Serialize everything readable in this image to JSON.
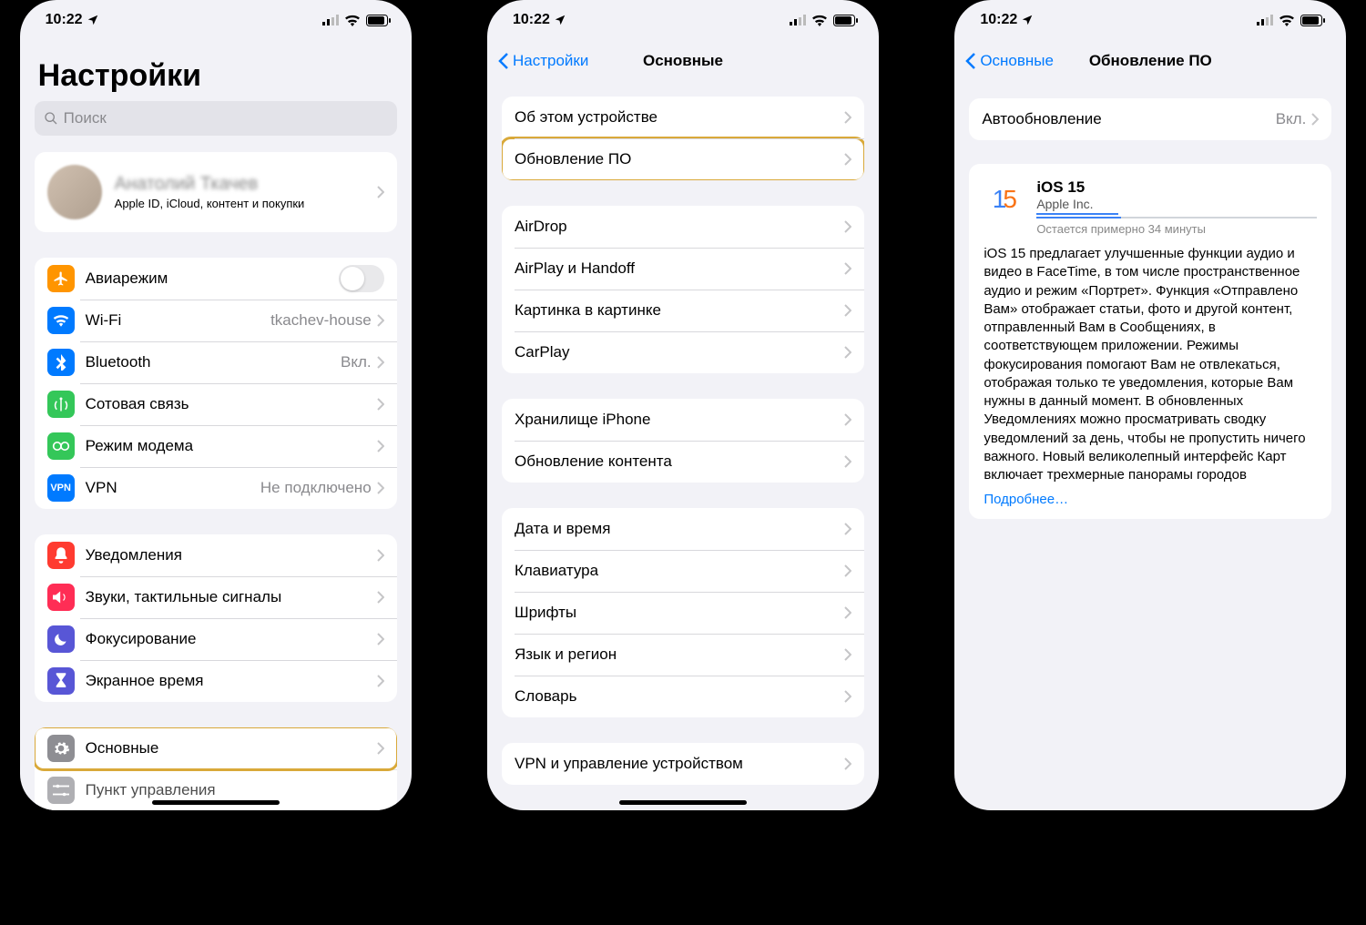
{
  "status": {
    "time": "10:22"
  },
  "screen1": {
    "title": "Настройки",
    "search_placeholder": "Поиск",
    "profile_name": "Анатолий Ткачев",
    "profile_sub": "Apple ID, iCloud, контент и покупки",
    "rows1": {
      "airplane": "Авиарежим",
      "wifi": "Wi-Fi",
      "wifi_value": "tkachev-house",
      "bluetooth": "Bluetooth",
      "bluetooth_value": "Вкл.",
      "cellular": "Сотовая связь",
      "hotspot": "Режим модема",
      "vpn": "VPN",
      "vpn_value": "Не подключено"
    },
    "rows2": {
      "notifications": "Уведомления",
      "sounds": "Звуки, тактильные сигналы",
      "focus": "Фокусирование",
      "screentime": "Экранное время"
    },
    "rows3": {
      "general": "Основные",
      "control": "Пункт управления"
    }
  },
  "screen2": {
    "back": "Настройки",
    "title": "Основные",
    "g1": {
      "about": "Об этом устройстве",
      "update": "Обновление ПО"
    },
    "g2": {
      "airdrop": "AirDrop",
      "airplay": "AirPlay и Handoff",
      "pip": "Картинка в картинке",
      "carplay": "CarPlay"
    },
    "g3": {
      "storage": "Хранилище iPhone",
      "refresh": "Обновление контента"
    },
    "g4": {
      "datetime": "Дата и время",
      "keyboard": "Клавиатура",
      "fonts": "Шрифты",
      "lang": "Язык и регион",
      "dict": "Словарь"
    },
    "g5": {
      "vpnmgmt": "VPN и управление устройством"
    }
  },
  "screen3": {
    "back": "Основные",
    "title": "Обновление ПО",
    "auto_label": "Автообновление",
    "auto_value": "Вкл.",
    "os_title": "iOS 15",
    "os_vendor": "Apple Inc.",
    "eta": "Остается примерно 34 минуты",
    "body": "iOS 15 предлагает улучшенные функции аудио и видео в FaceTime, в том числе пространственное аудио и режим «Портрет». Функция «Отправлено Вам» отображает статьи, фото и другой контент, отправленный Вам в Сообщениях, в соответствующем приложении. Режимы фокусирования помогают Вам не отвлекаться, отображая только те уведомления, которые Вам нужны в данный момент. В обновленных Уведомлениях можно просматривать сводку уведомлений за день, чтобы не пропустить ничего важного. Новый великолепный интерфейс Карт включает трехмерные панорамы городов",
    "more": "Подробнее…"
  }
}
